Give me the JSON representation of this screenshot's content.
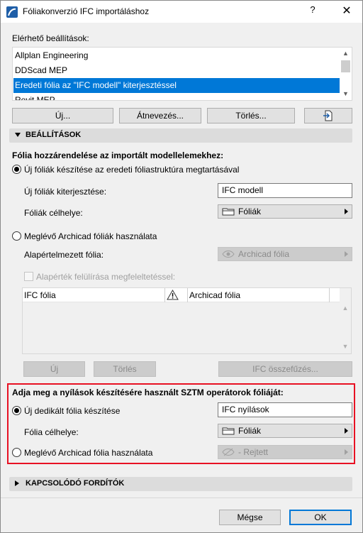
{
  "window": {
    "title": "Fóliakonverzió IFC importáláshoz",
    "help_label": "?",
    "close_label": "✕"
  },
  "presets": {
    "label": "Elérhető beállítások:",
    "items": [
      {
        "label": "Allplan Engineering"
      },
      {
        "label": "DDScad MEP"
      },
      {
        "label": "Eredeti fólia az \"IFC modell\" kiterjesztéssel"
      },
      {
        "label": "Revit MEP"
      }
    ],
    "selected_index": 2,
    "buttons": {
      "new": "Új...",
      "rename": "Átnevezés...",
      "delete": "Törlés..."
    }
  },
  "settings": {
    "section_title": "BEÁLLÍTÁSOK",
    "heading": "Fólia hozzárendelése az importált modellelemekhez:",
    "option_new": {
      "label": "Új fóliák készítése az eredeti fóliastruktúra megtartásával",
      "selected": true,
      "ext_label": "Új fóliák kiterjesztése:",
      "ext_value": "IFC modell",
      "dest_label": "Fóliák célhelye:",
      "dest_value": "Fóliák"
    },
    "option_existing": {
      "label": "Meglévő Archicad fóliák használata",
      "selected": false,
      "default_label": "Alapértelmezett fólia:",
      "default_value": "Archicad fólia",
      "override_label": "Alapérték felülírása megfeleltetéssel:",
      "override_checked": false
    },
    "table": {
      "headers": [
        "IFC fólia",
        "Archicad fólia"
      ],
      "warning_icon": "warning-icon"
    },
    "table_buttons": {
      "new": "Új",
      "delete": "Törlés",
      "merge": "IFC összefűzés..."
    }
  },
  "openings": {
    "heading": "Adja meg a nyílások készítésére használt SZTM operátorok fóliáját:",
    "option_new": {
      "label": "Új dedikált fólia készítése",
      "selected": true,
      "value": "IFC nyílások",
      "dest_label": "Fólia célhelye:",
      "dest_value": "Fóliák"
    },
    "option_existing": {
      "label": "Meglévő Archicad fólia használata",
      "selected": false,
      "value": "- Rejtett"
    }
  },
  "related": {
    "section_title": "KAPCSOLÓDÓ FORDÍTÓK"
  },
  "footer": {
    "cancel": "Mégse",
    "ok": "OK"
  },
  "colors": {
    "accent": "#0078d7",
    "highlight_border": "#e81123"
  }
}
